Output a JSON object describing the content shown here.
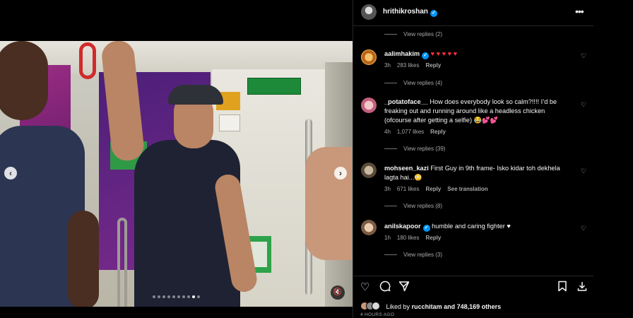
{
  "post": {
    "username": "hrithikroshan",
    "likes_text": "Liked by",
    "likes_user": "rucchitam",
    "likes_others": "and 748,169 others",
    "timestamp": "4 HOURS AGO",
    "carousel_total": 10,
    "carousel_active": 9
  },
  "comments": [
    {
      "type": "replies",
      "label": "View replies (2)"
    },
    {
      "type": "comment",
      "user": "aalimhakim",
      "verified": true,
      "text": "♥ ♥ ♥ ♥ ♥",
      "time": "3h",
      "likes": "283 likes",
      "reply": "Reply"
    },
    {
      "type": "replies",
      "label": "View replies (4)"
    },
    {
      "type": "comment",
      "user": "_potatoface__",
      "verified": false,
      "text": "How does everybody look so calm?!!!! I’d be freaking out and running around like a headless chicken (ofcourse after getting a selfie) 😂💕💕",
      "time": "4h",
      "likes": "1,077 likes",
      "reply": "Reply"
    },
    {
      "type": "replies",
      "label": "View replies (39)"
    },
    {
      "type": "comment",
      "user": "mohseen_kazi",
      "verified": false,
      "text": "First Guy in 9th frame- Isko kidar toh dekhela lagta hai...😳",
      "time": "3h",
      "likes": "671 likes",
      "reply": "Reply",
      "translate": "See translation"
    },
    {
      "type": "replies",
      "label": "View replies (8)"
    },
    {
      "type": "comment",
      "user": "anilskapoor",
      "verified": true,
      "text": "humble and caring fighter ♥",
      "time": "1h",
      "likes": "180 likes",
      "reply": "Reply"
    },
    {
      "type": "replies",
      "label": "View replies (3)"
    }
  ],
  "colors": {
    "verified": "#0095f6",
    "heart": "#ff3040",
    "muted_text": "#a8a8a8"
  },
  "icons": {
    "like": "heart-outline-icon",
    "comment": "comment-bubble-icon",
    "share": "paper-plane-icon",
    "save": "bookmark-icon",
    "download": "download-icon",
    "more": "ellipsis-icon",
    "mute": "speaker-muted-icon"
  }
}
